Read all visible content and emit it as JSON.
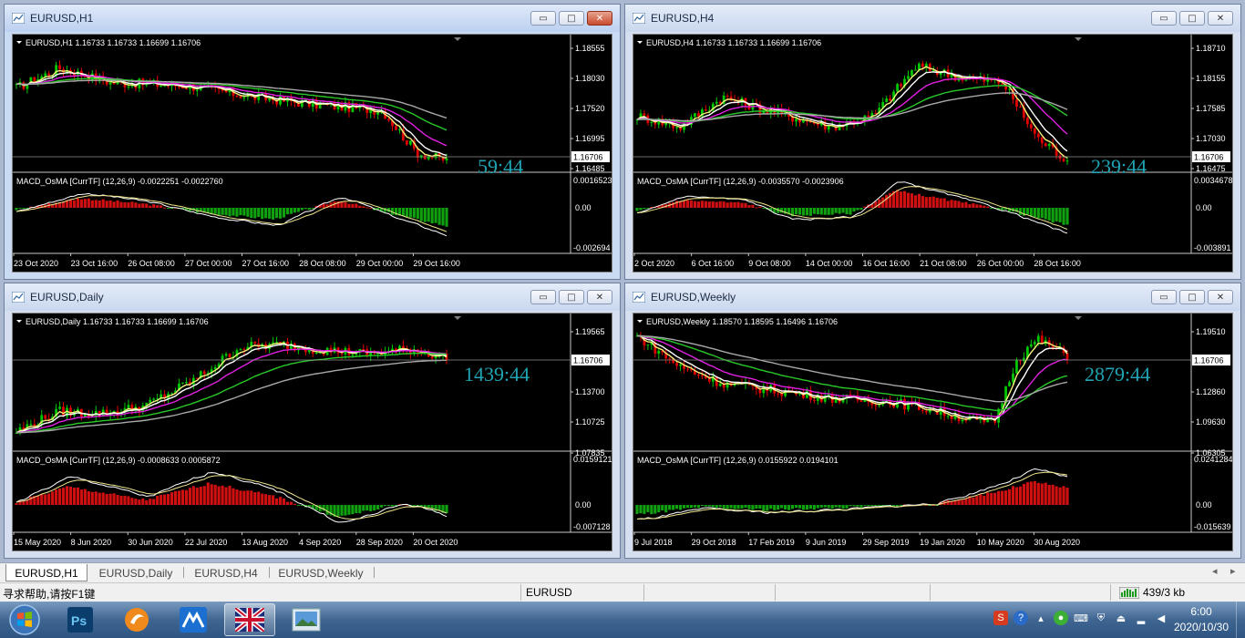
{
  "colors": {
    "bull": "#00c800",
    "bear": "#e00000",
    "bg": "#000000",
    "text": "#ffffff",
    "ma_yellow": "#f5f07a",
    "ma_white": "#ffffff",
    "ma_magenta": "#e020e0",
    "ma_green": "#28c828",
    "ma_gray": "#a8a8a8",
    "timer": "#20a4b4",
    "hist_pos": "#d01010",
    "hist_neg": "#10a010",
    "signal": "#f0e68c",
    "osma_line": "#ffffff"
  },
  "charts": [
    {
      "id": "h1",
      "window_title": "EURUSD,H1",
      "header": "EURUSD,H1  1.16733 1.16733 1.16699 1.16706",
      "indicator": "MACD_OsMA [CurrTF] (12,26,9) -0.0022251 -0.0022760",
      "timer": "59:44",
      "price_labels": [
        "1.18555",
        "1.18030",
        "1.17520",
        "1.16995",
        "1.16485"
      ],
      "current_price": "1.16706",
      "macd_labels": [
        "0.0016523",
        "0.00",
        "-0.002694"
      ],
      "time_labels": [
        "23 Oct 2020",
        "23 Oct 16:00",
        "26 Oct 08:00",
        "27 Oct 00:00",
        "27 Oct 16:00",
        "28 Oct 08:00",
        "29 Oct 00:00",
        "29 Oct 16:00"
      ]
    },
    {
      "id": "h4",
      "window_title": "EURUSD,H4",
      "header": "EURUSD,H4  1.16733 1.16733 1.16699 1.16706",
      "indicator": "MACD_OsMA [CurrTF] (12,26,9) -0.0035570 -0.0023906",
      "timer": "239:44",
      "price_labels": [
        "1.18710",
        "1.18155",
        "1.17585",
        "1.17030",
        "1.16475"
      ],
      "current_price": "1.16706",
      "macd_labels": [
        "0.0034678",
        "0.00",
        "-0.003891"
      ],
      "time_labels": [
        "2 Oct 2020",
        "6 Oct 16:00",
        "9 Oct 08:00",
        "14 Oct 00:00",
        "16 Oct 16:00",
        "21 Oct 08:00",
        "26 Oct 00:00",
        "28 Oct 16:00"
      ]
    },
    {
      "id": "daily",
      "window_title": "EURUSD,Daily",
      "header": "EURUSD,Daily  1.16733 1.16733 1.16699 1.16706",
      "indicator": "MACD_OsMA [CurrTF] (12,26,9) -0.0008633 0.0005872",
      "timer": "1439:44",
      "price_labels": [
        "1.19565",
        "1.16706",
        "1.13700",
        "1.10725",
        "1.07835"
      ],
      "current_price": "1.16706",
      "macd_labels": [
        "0.0159121",
        "0.00",
        "-0.007128"
      ],
      "time_labels": [
        "15 May 2020",
        "8 Jun 2020",
        "30 Jun 2020",
        "22 Jul 2020",
        "13 Aug 2020",
        "4 Sep 2020",
        "28 Sep 2020",
        "20 Oct 2020"
      ]
    },
    {
      "id": "weekly",
      "window_title": "EURUSD,Weekly",
      "header": "EURUSD,Weekly  1.18570 1.18595 1.16496 1.16706",
      "indicator": "MACD_OsMA [CurrTF] (12,26,9) 0.0155922 0.0194101",
      "timer": "2879:44",
      "price_labels": [
        "1.19510",
        "1.16706",
        "1.12860",
        "1.09630",
        "1.06305"
      ],
      "current_price": "1.16706",
      "macd_labels": [
        "0.0241284",
        "0.00",
        "-0.015639"
      ],
      "time_labels": [
        "9 Jul 2018",
        "29 Oct 2018",
        "17 Feb 2019",
        "9 Jun 2019",
        "29 Sep 2019",
        "19 Jan 2020",
        "10 May 2020",
        "30 Aug 2020"
      ]
    }
  ],
  "tabs": [
    "EURUSD,H1",
    "EURUSD,Daily",
    "EURUSD,H4",
    "EURUSD,Weekly"
  ],
  "tab_nav": {
    "left": "◂",
    "right": "▸"
  },
  "window_buttons": {
    "minimize": "▭",
    "maximize": "□",
    "close": "✕"
  },
  "status": {
    "help": "寻求帮助,请按F1键",
    "symbol": "EURUSD",
    "traffic": "439/3 kb"
  },
  "taskbar": {
    "time": "6:00",
    "date": "2020/10/30"
  },
  "icons": [
    "chart-window-icon",
    "windows-start-icon",
    "photoshop-icon",
    "browser-icon",
    "meta-app-icon",
    "metatrader-icon",
    "image-viewer-icon"
  ]
}
